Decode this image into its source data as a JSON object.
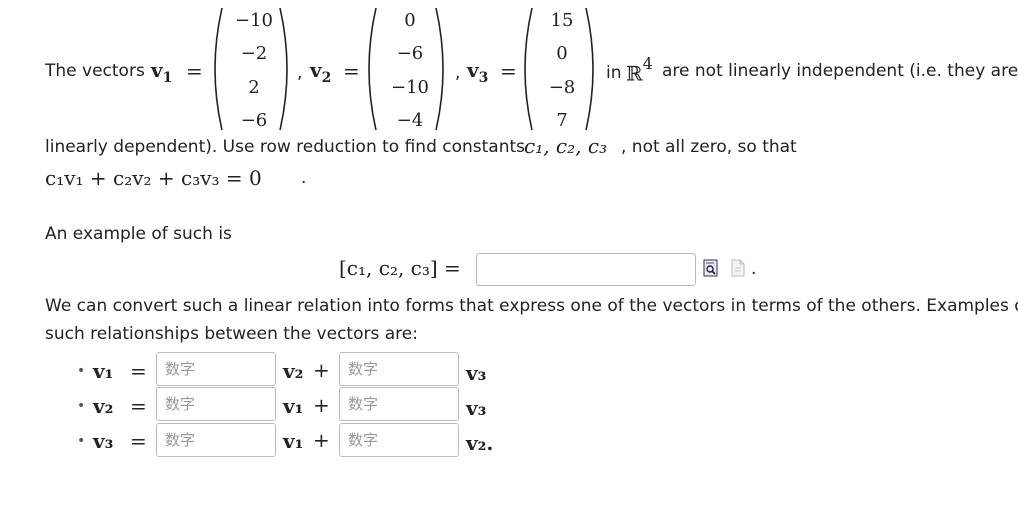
{
  "intro": {
    "prefix": "The vectors",
    "v1_name": "v",
    "v1_sub": "1",
    "v2_name": "v",
    "v2_sub": "2",
    "v3_name": "v",
    "v3_sub": "3",
    "equals": "=",
    "comma": ",",
    "in_text": "in",
    "R": "ℝ",
    "R_exp": "4",
    "suffix": "are not linearly independent (i.e. they are",
    "line2": "linearly dependent). Use row reduction to find constants",
    "constants": "c₁, c₂, c₃",
    "line2_end": ", not all zero, so that",
    "combo": "c₁v₁ + c₂v₂ + c₃v₃ = 0",
    "period": "."
  },
  "vectors": {
    "v1": [
      "−10",
      "−2",
      "2",
      "−6"
    ],
    "v2": [
      "0",
      "−6",
      "−10",
      "−4"
    ],
    "v3": [
      "15",
      "0",
      "−8",
      "7"
    ]
  },
  "example": {
    "label": "An example of such is",
    "lhs": "[c₁, c₂, c₃] =",
    "answer_value": "",
    "period": "."
  },
  "relations": {
    "text_line1": "We can convert such a linear relation into forms that express one of the vectors in terms of the others. Examples of",
    "text_line2": "such relationships between the vectors are:",
    "placeholder": "数字",
    "rows": [
      {
        "bullet": "•",
        "lhs": "v₁",
        "eq": "=",
        "mid": "v₂",
        "plus": "+",
        "end": "v₃",
        "end_punct": ""
      },
      {
        "bullet": "•",
        "lhs": "v₂",
        "eq": "=",
        "mid": "v₁",
        "plus": "+",
        "end": "v₃",
        "end_punct": ""
      },
      {
        "bullet": "•",
        "lhs": "v₃",
        "eq": "=",
        "mid": "v₁",
        "plus": "+",
        "end": "v₂",
        "end_punct": "."
      }
    ]
  },
  "icons": {
    "preview": "preview-icon",
    "help": "help-icon"
  },
  "colors": {
    "text": "#222222",
    "border": "#bbbbbb",
    "placeholder": "#999999"
  }
}
